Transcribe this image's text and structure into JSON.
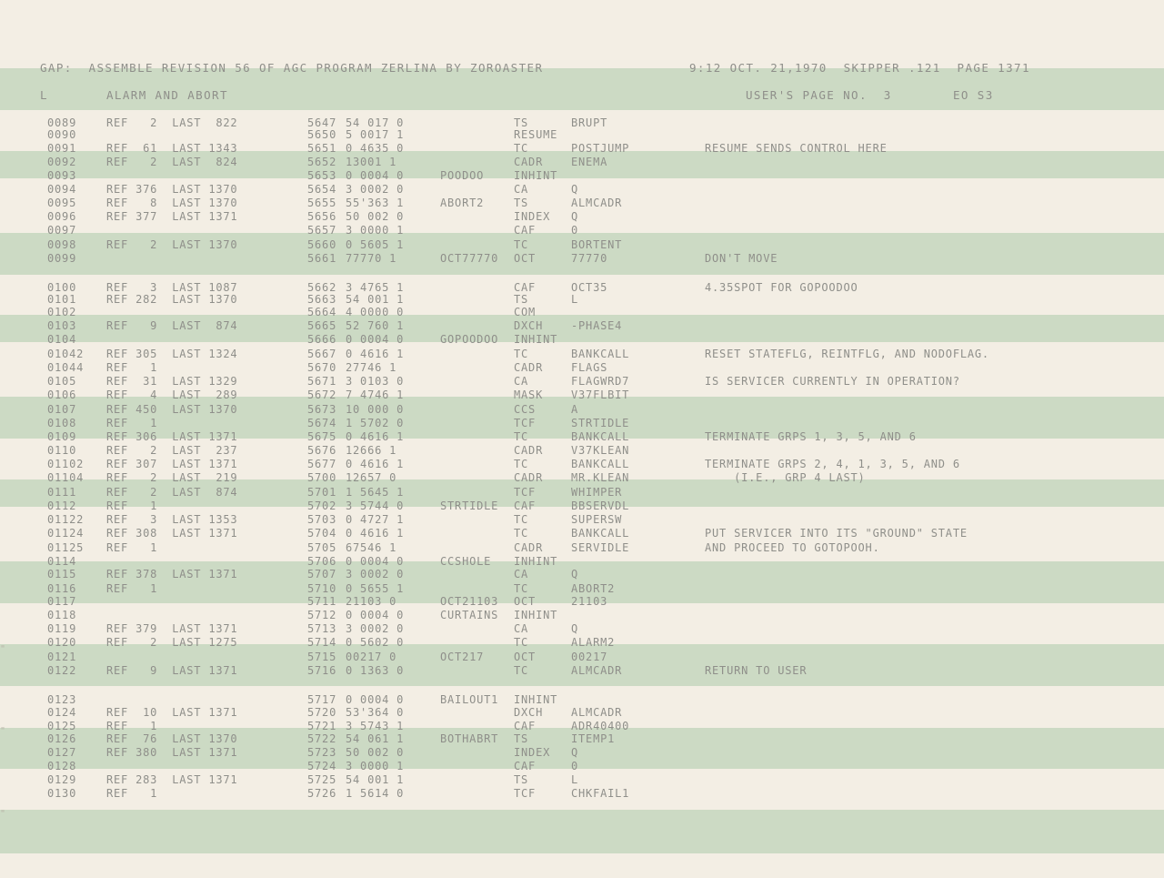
{
  "header": {
    "assembly_line": "GAP:  ASSEMBLE REVISION 56 OF AGC PROGRAM ZERLINA BY ZOROASTER",
    "datetime_line": "9:12 OCT. 21,1970  SKIPPER .121  PAGE 1371",
    "section_letter": "L",
    "section_title": "ALARM AND ABORT",
    "users_page": "USER'S PAGE NO.  3",
    "eo_label": "EO S3"
  },
  "listing": [
    {
      "line": "0089",
      "ref": "REF   2  LAST  822",
      "addr": "5647",
      "word": "54 017 0",
      "label": "",
      "op": "TS",
      "operand": "BRUPT",
      "comment": ""
    },
    {
      "line": "0090",
      "ref": "",
      "addr": "5650",
      "word": "5 0017 1",
      "label": "",
      "op": "RESUME",
      "operand": "",
      "comment": ""
    },
    {
      "line": "0091",
      "ref": "REF  61  LAST 1343",
      "addr": "5651",
      "word": "0 4635 0",
      "label": "",
      "op": "TC",
      "operand": "POSTJUMP",
      "comment": "RESUME SENDS CONTROL HERE"
    },
    {
      "line": "0092",
      "ref": "REF   2  LAST  824",
      "addr": "5652",
      "word": "13001 1",
      "label": "",
      "op": "CADR",
      "operand": "ENEMA",
      "comment": ""
    },
    {
      "line": "0093",
      "ref": "",
      "addr": "5653",
      "word": "0 0004 0",
      "label": "POODOO",
      "op": "INHINT",
      "operand": "",
      "comment": ""
    },
    {
      "line": "0094",
      "ref": "REF 376  LAST 1370",
      "addr": "5654",
      "word": "3 0002 0",
      "label": "",
      "op": "CA",
      "operand": "Q",
      "comment": ""
    },
    {
      "line": "0095",
      "ref": "REF   8  LAST 1370",
      "addr": "5655",
      "word": "55'363 1",
      "label": "ABORT2",
      "op": "TS",
      "operand": "ALMCADR",
      "comment": ""
    },
    {
      "line": "0096",
      "ref": "REF 377  LAST 1371",
      "addr": "5656",
      "word": "50 002 0",
      "label": "",
      "op": "INDEX",
      "operand": "Q",
      "comment": ""
    },
    {
      "line": "0097",
      "ref": "",
      "addr": "5657",
      "word": "3 0000 1",
      "label": "",
      "op": "CAF",
      "operand": "0",
      "comment": ""
    },
    {
      "line": "0098",
      "ref": "REF   2  LAST 1370",
      "addr": "5660",
      "word": "0 5605 1",
      "label": "",
      "op": "TC",
      "operand": "BORTENT",
      "comment": ""
    },
    {
      "line": "0099",
      "ref": "",
      "addr": "5661",
      "word": "77770 1",
      "label": "OCT77770",
      "op": "OCT",
      "operand": "77770",
      "comment": "DON'T MOVE"
    },
    {
      "line": "0100",
      "ref": "REF   3  LAST 1087",
      "addr": "5662",
      "word": "3 4765 1",
      "label": "",
      "op": "CAF",
      "operand": "OCT35",
      "comment": "4.35SPOT FOR GOPOODOO"
    },
    {
      "line": "0101",
      "ref": "REF 282  LAST 1370",
      "addr": "5663",
      "word": "54 001 1",
      "label": "",
      "op": "TS",
      "operand": "L",
      "comment": ""
    },
    {
      "line": "0102",
      "ref": "",
      "addr": "5664",
      "word": "4 0000 0",
      "label": "",
      "op": "COM",
      "operand": "",
      "comment": ""
    },
    {
      "line": "0103",
      "ref": "REF   9  LAST  874",
      "addr": "5665",
      "word": "52 760 1",
      "label": "",
      "op": "DXCH",
      "operand": "-PHASE4",
      "comment": ""
    },
    {
      "line": "0104",
      "ref": "",
      "addr": "5666",
      "word": "0 0004 0",
      "label": "GOPOODOO",
      "op": "INHINT",
      "operand": "",
      "comment": ""
    },
    {
      "line": "01042",
      "ref": "REF 305  LAST 1324",
      "addr": "5667",
      "word": "0 4616 1",
      "label": "",
      "op": "TC",
      "operand": "BANKCALL",
      "comment": "RESET STATEFLG, REINTFLG, AND NODOFLAG."
    },
    {
      "line": "01044",
      "ref": "REF   1",
      "addr": "5670",
      "word": "27746 1",
      "label": "",
      "op": "CADR",
      "operand": "FLAGS",
      "comment": ""
    },
    {
      "line": "0105",
      "ref": "REF  31  LAST 1329",
      "addr": "5671",
      "word": "3 0103 0",
      "label": "",
      "op": "CA",
      "operand": "FLAGWRD7",
      "comment": "IS SERVICER CURRENTLY IN OPERATION?"
    },
    {
      "line": "0106",
      "ref": "REF   4  LAST  289",
      "addr": "5672",
      "word": "7 4746 1",
      "label": "",
      "op": "MASK",
      "operand": "V37FLBIT",
      "comment": ""
    },
    {
      "line": "0107",
      "ref": "REF 450  LAST 1370",
      "addr": "5673",
      "word": "10 000 0",
      "label": "",
      "op": "CCS",
      "operand": "A",
      "comment": ""
    },
    {
      "line": "0108",
      "ref": "REF   1",
      "addr": "5674",
      "word": "1 5702 0",
      "label": "",
      "op": "TCF",
      "operand": "STRTIDLE",
      "comment": ""
    },
    {
      "line": "0109",
      "ref": "REF 306  LAST 1371",
      "addr": "5675",
      "word": "0 4616 1",
      "label": "",
      "op": "TC",
      "operand": "BANKCALL",
      "comment": "TERMINATE GRPS 1, 3, 5, AND 6"
    },
    {
      "line": "0110",
      "ref": "REF   2  LAST  237",
      "addr": "5676",
      "word": "12666 1",
      "label": "",
      "op": "CADR",
      "operand": "V37KLEAN",
      "comment": ""
    },
    {
      "line": "01102",
      "ref": "REF 307  LAST 1371",
      "addr": "5677",
      "word": "0 4616 1",
      "label": "",
      "op": "TC",
      "operand": "BANKCALL",
      "comment": "TERMINATE GRPS 2, 4, 1, 3, 5, AND 6"
    },
    {
      "line": "01104",
      "ref": "REF   2  LAST  219",
      "addr": "5700",
      "word": "12657 0",
      "label": "",
      "op": "CADR",
      "operand": "MR.KLEAN",
      "comment": "    (I.E., GRP 4 LAST)"
    },
    {
      "line": "0111",
      "ref": "REF   2  LAST  874",
      "addr": "5701",
      "word": "1 5645 1",
      "label": "",
      "op": "TCF",
      "operand": "WHIMPER",
      "comment": ""
    },
    {
      "line": "0112",
      "ref": "REF   1",
      "addr": "5702",
      "word": "3 5744 0",
      "label": "STRTIDLE",
      "op": "CAF",
      "operand": "BBSERVDL",
      "comment": ""
    },
    {
      "line": "01122",
      "ref": "REF   3  LAST 1353",
      "addr": "5703",
      "word": "0 4727 1",
      "label": "",
      "op": "TC",
      "operand": "SUPERSW",
      "comment": ""
    },
    {
      "line": "01124",
      "ref": "REF 308  LAST 1371",
      "addr": "5704",
      "word": "0 4616 1",
      "label": "",
      "op": "TC",
      "operand": "BANKCALL",
      "comment": "PUT SERVICER INTO ITS \"GROUND\" STATE"
    },
    {
      "line": "01125",
      "ref": "REF   1",
      "addr": "5705",
      "word": "67546 1",
      "label": "",
      "op": "CADR",
      "operand": "SERVIDLE",
      "comment": "AND PROCEED TO GOTOPOOH."
    },
    {
      "line": "0114",
      "ref": "",
      "addr": "5706",
      "word": "0 0004 0",
      "label": "CCSHOLE",
      "op": "INHINT",
      "operand": "",
      "comment": ""
    },
    {
      "line": "0115",
      "ref": "REF 378  LAST 1371",
      "addr": "5707",
      "word": "3 0002 0",
      "label": "",
      "op": "CA",
      "operand": "Q",
      "comment": ""
    },
    {
      "line": "0116",
      "ref": "REF   1",
      "addr": "5710",
      "word": "0 5655 1",
      "label": "",
      "op": "TC",
      "operand": "ABORT2",
      "comment": ""
    },
    {
      "line": "0117",
      "ref": "",
      "addr": "5711",
      "word": "21103 0",
      "label": "OCT21103",
      "op": "OCT",
      "operand": "21103",
      "comment": ""
    },
    {
      "line": "0118",
      "ref": "",
      "addr": "5712",
      "word": "0 0004 0",
      "label": "CURTAINS",
      "op": "INHINT",
      "operand": "",
      "comment": ""
    },
    {
      "line": "0119",
      "ref": "REF 379  LAST 1371",
      "addr": "5713",
      "word": "3 0002 0",
      "label": "",
      "op": "CA",
      "operand": "Q",
      "comment": ""
    },
    {
      "line": "0120",
      "ref": "REF   2  LAST 1275",
      "addr": "5714",
      "word": "0 5602 0",
      "label": "",
      "op": "TC",
      "operand": "ALARM2",
      "comment": ""
    },
    {
      "line": "0121",
      "ref": "",
      "addr": "5715",
      "word": "00217 0",
      "label": "OCT217",
      "op": "OCT",
      "operand": "00217",
      "comment": ""
    },
    {
      "line": "0122",
      "ref": "REF   9  LAST 1371",
      "addr": "5716",
      "word": "0 1363 0",
      "label": "",
      "op": "TC",
      "operand": "ALMCADR",
      "comment": "RETURN TO USER"
    },
    {
      "line": "0123",
      "ref": "",
      "addr": "5717",
      "word": "0 0004 0",
      "label": "BAILOUT1",
      "op": "INHINT",
      "operand": "",
      "comment": ""
    },
    {
      "line": "0124",
      "ref": "REF  10  LAST 1371",
      "addr": "5720",
      "word": "53'364 0",
      "label": "",
      "op": "DXCH",
      "operand": "ALMCADR",
      "comment": ""
    },
    {
      "line": "0125",
      "ref": "REF   1",
      "addr": "5721",
      "word": "3 5743 1",
      "label": "",
      "op": "CAF",
      "operand": "ADR40400",
      "comment": ""
    },
    {
      "line": "0126",
      "ref": "REF  76  LAST 1370",
      "addr": "5722",
      "word": "54 061 1",
      "label": "BOTHABRT",
      "op": "TS",
      "operand": "ITEMP1",
      "comment": ""
    },
    {
      "line": "0127",
      "ref": "REF 380  LAST 1371",
      "addr": "5723",
      "word": "50 002 0",
      "label": "",
      "op": "INDEX",
      "operand": "Q",
      "comment": ""
    },
    {
      "line": "0128",
      "ref": "",
      "addr": "5724",
      "word": "3 0000 1",
      "label": "",
      "op": "CAF",
      "operand": "0",
      "comment": ""
    },
    {
      "line": "0129",
      "ref": "REF 283  LAST 1371",
      "addr": "5725",
      "word": "54 001 1",
      "label": "",
      "op": "TS",
      "operand": "L",
      "comment": ""
    },
    {
      "line": "0130",
      "ref": "REF   1",
      "addr": "5726",
      "word": "1 5614 0",
      "label": "",
      "op": "TCF",
      "operand": "CHKFAIL1",
      "comment": ""
    }
  ]
}
